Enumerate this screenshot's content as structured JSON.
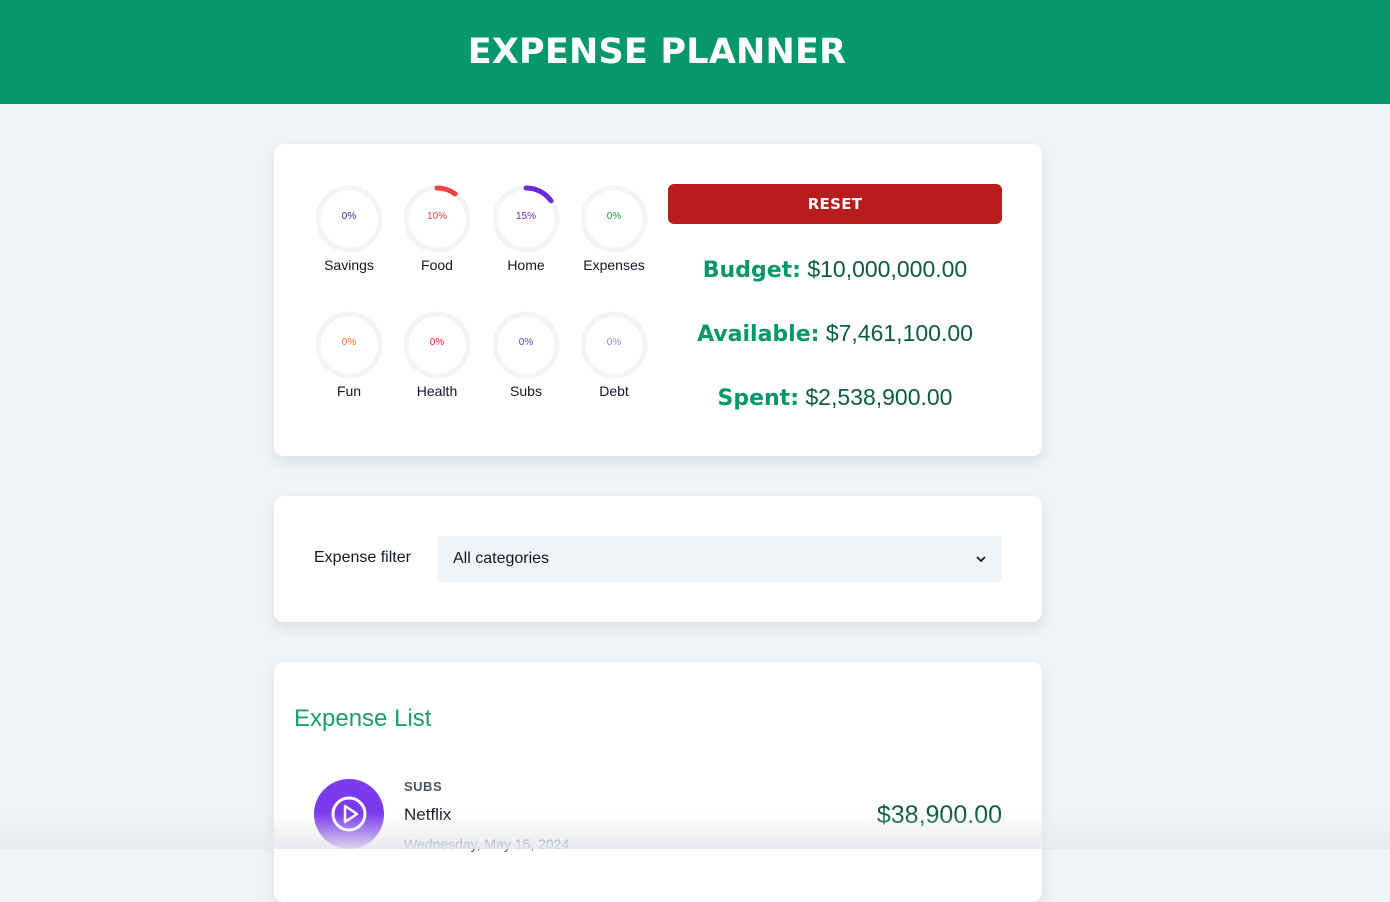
{
  "header": {
    "title": "EXPENSE PLANNER"
  },
  "budget": {
    "categories": [
      {
        "label": "Savings",
        "percent_text": "0%",
        "percent": 0,
        "color": "#4c1d95"
      },
      {
        "label": "Food",
        "percent_text": "10%",
        "percent": 10,
        "color": "#ef4444"
      },
      {
        "label": "Home",
        "percent_text": "15%",
        "percent": 15,
        "color": "#6d28d9"
      },
      {
        "label": "Expenses",
        "percent_text": "0%",
        "percent": 0,
        "color": "#16a34a"
      },
      {
        "label": "Fun",
        "percent_text": "0%",
        "percent": 0,
        "color": "#f97316"
      },
      {
        "label": "Health",
        "percent_text": "0%",
        "percent": 0,
        "color": "#dc2626"
      },
      {
        "label": "Subs",
        "percent_text": "0%",
        "percent": 0,
        "color": "#4f46e5"
      },
      {
        "label": "Debt",
        "percent_text": "0%",
        "percent": 0,
        "color": "#8b8bd8"
      }
    ],
    "ring_track_color": "#f3f4f6",
    "reset_label": "RESET",
    "budget_label": "Budget:",
    "budget_value": "$10,000,000.00",
    "available_label": "Available:",
    "available_value": "$7,461,100.00",
    "spent_label": "Spent:",
    "spent_value": "$2,538,900.00"
  },
  "filter": {
    "label": "Expense filter",
    "selected": "All categories"
  },
  "expense_list": {
    "title": "Expense List",
    "items": [
      {
        "category": "SUBS",
        "name": "Netflix",
        "date": "Wednesday, May 15, 2024",
        "amount": "$38,900.00",
        "icon": "play-icon"
      }
    ]
  },
  "colors": {
    "brand": "#06976a",
    "reset": "#b91c1c",
    "subs_icon_bg": "#7c3aed"
  }
}
